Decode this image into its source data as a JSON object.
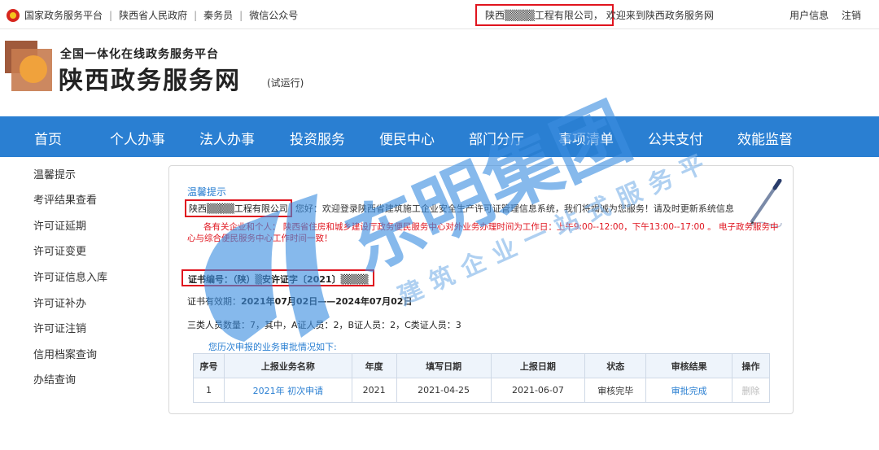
{
  "topbar": {
    "links": [
      "国家政务服务平台",
      "陕西省人民政府",
      "秦务员",
      "微信公众号"
    ],
    "company": "陕西▒▒▒▒工程有限公司，",
    "welcome": "欢迎来到陕西政务服务网",
    "user_info": "用户信息",
    "logout": "注销"
  },
  "header": {
    "subtitle": "全国一体化在线政务服务平台",
    "title": "陕西政务服务网",
    "trial": "(试运行)"
  },
  "nav": [
    "首页",
    "个人办事",
    "法人办事",
    "投资服务",
    "便民中心",
    "部门分厅",
    "事项清单",
    "公共支付",
    "效能监督"
  ],
  "sidebar": [
    "温馨提示",
    "考评结果查看",
    "许可证延期",
    "许可证变更",
    "许可证信息入库",
    "许可证补办",
    "许可证注销",
    "信用档案查询",
    "办结查询"
  ],
  "main": {
    "greet_title": "温馨提示",
    "company": "陕西▒▒▒▒工程有限公司",
    "welcome_text": "您好：欢迎登录陕西省建筑施工企业安全生产许可证管理信息系统，我们将竭诚为您服务！请及时更新系统信息",
    "notice": "各有关企业和个人：   陕西省住房和城乡建设厅政务便民服务中心对外业务办理时间为工作日：上午9:00--12:00，下午13:00--17:00 。 电子政务服务中心与综合便民服务中心工作时间一致！",
    "cert_no": "证书编号：（陕）▒安许证字〔2021〕▒▒▒▒",
    "validity_label": "证书有效期：",
    "validity_value": "2021年07月02日——2024年07月02日",
    "staff": "三类人员数量：7，其中，A证人员：2，B证人员：2，C类证人员：3",
    "history_title": "您历次申报的业务审批情况如下:",
    "table": {
      "headers": [
        "序号",
        "上报业务名称",
        "年度",
        "填写日期",
        "上报日期",
        "状态",
        "审核结果",
        "操作"
      ],
      "rows": [
        [
          "1",
          "2021年 初次申请",
          "2021",
          "2021-04-25",
          "2021-06-07",
          "审核完毕",
          "审批完成",
          "删除"
        ]
      ]
    }
  },
  "watermark": {
    "main": "东明集团",
    "sub": "建筑企业一站式服务平台"
  },
  "colors": {
    "nav": "#2a7fd2",
    "highlight": "#e0141e",
    "link": "#2a7fd2"
  }
}
